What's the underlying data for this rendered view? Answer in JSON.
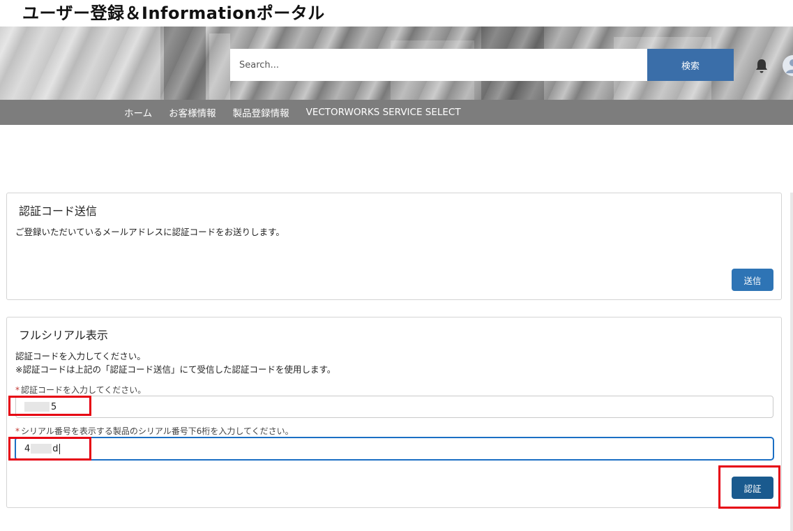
{
  "header": {
    "site_title": "ユーザー登録＆Informationポータル",
    "search": {
      "placeholder": "Search...",
      "value": ""
    },
    "search_button_label": "検索"
  },
  "nav": {
    "items": [
      {
        "label": "ホーム"
      },
      {
        "label": "お客様情報"
      },
      {
        "label": "製品登録情報"
      },
      {
        "label": "VECTORWORKS SERVICE SELECT"
      }
    ]
  },
  "send_code_card": {
    "title": "認証コード送信",
    "description": "ご登録いただいているメールアドレスに認証コードをお送りします。",
    "send_button_label": "送信"
  },
  "serial_card": {
    "title": "フルシリアル表示",
    "instruction_line1": "認証コードを入力してください。",
    "instruction_line2": "※認証コードは上記の「認証コード送信」にて受信した認証コードを使用します。",
    "required_mark": "*",
    "code_label": "認証コードを入力してください。",
    "code_value": "5",
    "serial_label": "シリアル番号を表示する製品のシリアル番号下6桁を入力してください。",
    "serial_value_start": "4",
    "serial_value_end": "d",
    "verify_button_label": "認証"
  },
  "icons": {
    "bell": "bell-icon",
    "avatar": "user-avatar-icon"
  },
  "colors": {
    "primary_button": "#2e74b5",
    "verify_button": "#1a5a8e",
    "search_button": "#3a6ea9",
    "highlight": "#e60012",
    "required": "#c23934"
  }
}
